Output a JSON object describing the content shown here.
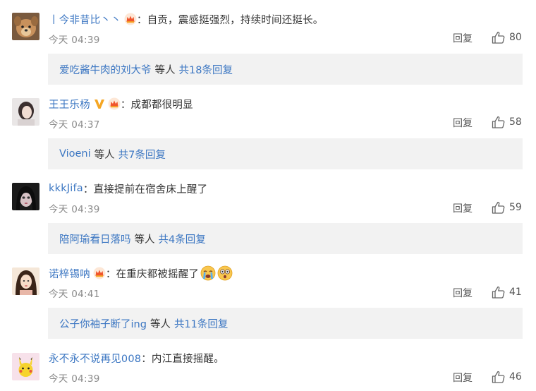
{
  "comments": [
    {
      "username": "丨今非昔比丶丶",
      "text": "自贡，震感挺强烈，持续时间还挺长。",
      "time": "今天 04:39",
      "reply_label": "回复",
      "likes": "80",
      "avatar": "dog-avatar",
      "has_crown_badge": true,
      "has_v_badge": false,
      "replies": {
        "name": "爱吃酱牛肉的刘大爷",
        "etc": "等人",
        "total": "共18条回复"
      }
    },
    {
      "username": "王王乐杨",
      "text": "成都都很明显",
      "time": "今天 04:37",
      "reply_label": "回复",
      "likes": "58",
      "avatar": "girl-avatar",
      "has_crown_badge": true,
      "has_v_badge": true,
      "replies": {
        "name": "Vioeni",
        "etc": "等人",
        "total": "共7条回复"
      }
    },
    {
      "username": "kkkJifa",
      "text": "直接提前在宿舍床上醒了",
      "time": "今天 04:39",
      "reply_label": "回复",
      "likes": "59",
      "avatar": "doll-avatar",
      "has_crown_badge": false,
      "has_v_badge": false,
      "replies": {
        "name": "陪阿瑜看日落吗",
        "etc": "等人",
        "total": "共4条回复"
      }
    },
    {
      "username": "诺梓锡呐",
      "text": "在重庆都被摇醒了",
      "time": "今天 04:41",
      "reply_label": "回复",
      "likes": "41",
      "avatar": "woman-avatar",
      "has_crown_badge": true,
      "has_v_badge": false,
      "emojis": [
        "crying-emoji",
        "shocked-emoji"
      ],
      "replies": {
        "name": "公子你袖子断了ing",
        "etc": "等人",
        "total": "共11条回复"
      }
    },
    {
      "username": "永不永不说再见008",
      "text": "内江直接摇醒。",
      "time": "今天 04:39",
      "reply_label": "回复",
      "likes": "46",
      "avatar": "pikachu-avatar",
      "has_crown_badge": false,
      "has_v_badge": false
    }
  ],
  "colon": "：",
  "colors": {
    "link": "#3b76c2",
    "text": "#333333",
    "meta": "#8a8a8a",
    "reply_bg": "#f2f2f2"
  }
}
